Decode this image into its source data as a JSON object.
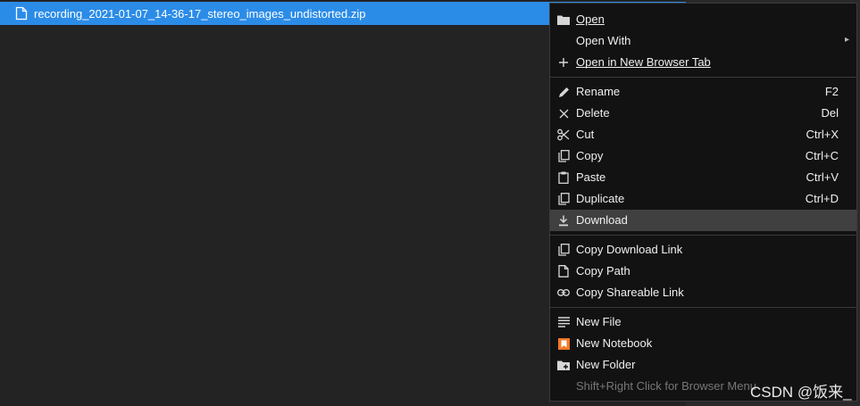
{
  "file": {
    "name": "recording_2021-01-07_14-36-17_stereo_images_undistorted.zip"
  },
  "menu": {
    "items": [
      {
        "label": "Open",
        "shortcut": "",
        "icon": "folder-icon"
      },
      {
        "label": "Open With",
        "shortcut": "",
        "icon": "",
        "submenu": true
      },
      {
        "label": "Open in New Browser Tab",
        "shortcut": "",
        "icon": "plus-icon"
      },
      {
        "label": "Rename",
        "shortcut": "F2",
        "icon": "pencil-icon"
      },
      {
        "label": "Delete",
        "shortcut": "Del",
        "icon": "close-icon"
      },
      {
        "label": "Cut",
        "shortcut": "Ctrl+X",
        "icon": "scissors-icon"
      },
      {
        "label": "Copy",
        "shortcut": "Ctrl+C",
        "icon": "copy-icon"
      },
      {
        "label": "Paste",
        "shortcut": "Ctrl+V",
        "icon": "clipboard-icon"
      },
      {
        "label": "Duplicate",
        "shortcut": "Ctrl+D",
        "icon": "copy-icon"
      },
      {
        "label": "Download",
        "shortcut": "",
        "icon": "download-icon",
        "active": true
      },
      {
        "label": "Copy Download Link",
        "shortcut": "",
        "icon": "copy-icon"
      },
      {
        "label": "Copy Path",
        "shortcut": "",
        "icon": "file-icon"
      },
      {
        "label": "Copy Shareable Link",
        "shortcut": "",
        "icon": "link-icon"
      },
      {
        "label": "New File",
        "shortcut": "",
        "icon": "text-file-icon"
      },
      {
        "label": "New Notebook",
        "shortcut": "",
        "icon": "notebook-icon"
      },
      {
        "label": "New Folder",
        "shortcut": "",
        "icon": "new-folder-icon"
      },
      {
        "label": "Shift+Right Click for Browser Menu",
        "shortcut": "",
        "icon": "",
        "disabled": true
      }
    ],
    "submenu_arrow": "▸"
  },
  "watermark": "CSDN @饭来_",
  "colors": {
    "selection": "#2b8ce8",
    "menu_bg": "#121212",
    "hover": "#404040",
    "notebook": "#f37726"
  }
}
